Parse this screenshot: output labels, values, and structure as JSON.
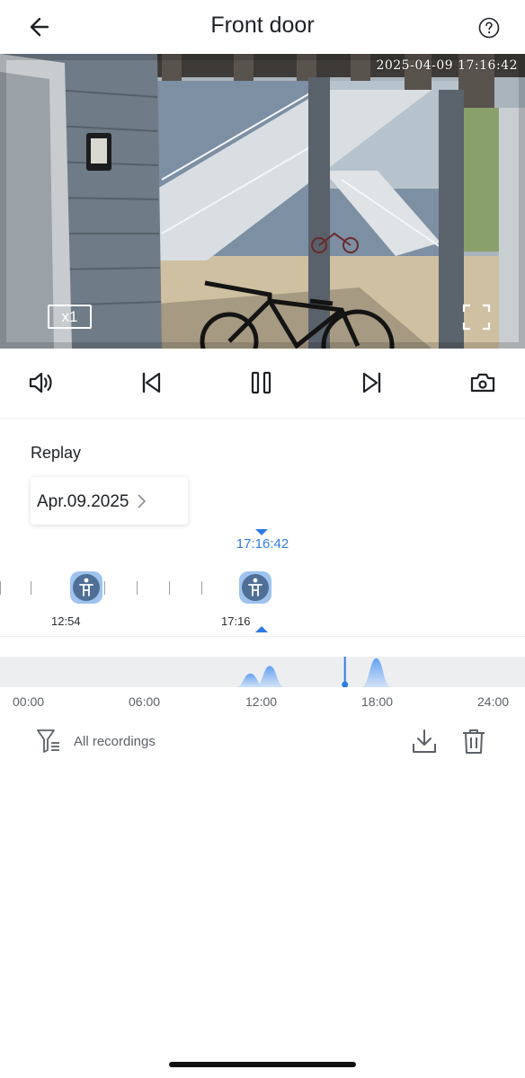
{
  "header": {
    "title": "Front door",
    "back_icon": "arrow-left-icon",
    "help_icon": "question-circle-icon"
  },
  "video": {
    "timestamp": "2025-04-09 17:16:42",
    "zoom": "x1",
    "fullscreen_icon": "fullscreen-icon"
  },
  "controls": [
    {
      "icon": "speaker-icon"
    },
    {
      "icon": "skip-previous-icon"
    },
    {
      "icon": "pause-icon"
    },
    {
      "icon": "skip-next-icon"
    },
    {
      "icon": "camera-snapshot-icon"
    }
  ],
  "replay": {
    "label": "Replay",
    "date": "Apr.09.2025"
  },
  "events": {
    "current_time": "17:16:42",
    "items": [
      {
        "time": "12:54",
        "icon": "person-detected-icon"
      },
      {
        "time": "17:16",
        "icon": "person-detected-icon"
      }
    ]
  },
  "timeline": {
    "axis_labels": [
      "00:00",
      "06:00",
      "12:00",
      "18:00",
      "24:00"
    ],
    "cursor_hour": 16.28,
    "activity_peaks_hour": [
      11.4,
      12.4,
      17.9
    ],
    "accent_color": "#2f7be5"
  },
  "bottom_bar": {
    "filter_label": "All recordings",
    "filter_icon": "filter-icon",
    "download_icon": "download-icon",
    "delete_icon": "trash-icon"
  }
}
